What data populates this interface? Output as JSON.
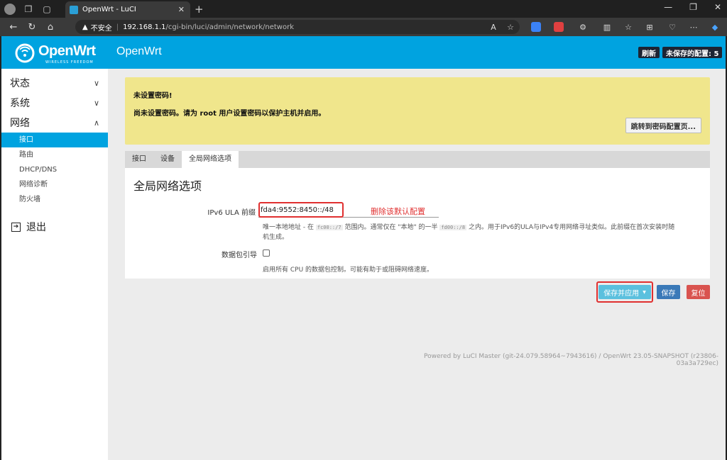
{
  "browser": {
    "tab_title": "OpenWrt - LuCI",
    "security_label": "不安全",
    "url_host": "192.168.1.1",
    "url_path": "/cgi-bin/luci/admin/network/network"
  },
  "header": {
    "logo_text": "OpenWrt",
    "logo_tagline": "WIRELESS FREEDOM",
    "brand": "OpenWrt",
    "refresh_label": "刷新",
    "unsaved_label": "未保存的配置: 5"
  },
  "sidebar": {
    "sections": [
      {
        "label": "状态"
      },
      {
        "label": "系统"
      },
      {
        "label": "网络"
      }
    ],
    "network_items": [
      "接口",
      "路由",
      "DHCP/DNS",
      "网络诊断",
      "防火墙"
    ],
    "logout_label": "退出"
  },
  "alert": {
    "title": "未设置密码!",
    "message": "尚未设置密码。请为 root 用户设置密码以保护主机并启用。",
    "button_label": "跳转到密码配置页..."
  },
  "tabs": [
    "接口",
    "设备",
    "全局网络选项"
  ],
  "panel": {
    "title": "全局网络选项",
    "ula_label": "IPv6 ULA 前缀",
    "ula_value": "fda4:9552:8450::/48",
    "annotation": "删除该默认配置",
    "ula_help_1": "唯一本地地址 - 在",
    "ula_help_code1": "fc00::/7",
    "ula_help_2": "范围内。通常仅在 \"本地\" 的一半",
    "ula_help_code2": "fd00::/8",
    "ula_help_3": "之内。用于IPv6的ULA与IPv4专用网络寻址类似。此前缀在首次安装时随",
    "ula_help_4": "机生成。",
    "steering_label": "数据包引导",
    "steering_help": "启用所有 CPU 的数据包控制。可能有助于或阻碍网络速度。"
  },
  "actions": {
    "save_apply": "保存并应用",
    "save": "保存",
    "reset": "复位"
  },
  "footer": "Powered by LuCI Master (git-24.079.58964~7943616) / OpenWrt 23.05-SNAPSHOT (r23806-03a3a729ec)",
  "colors": {
    "accent": "#00a3e0",
    "alert_bg": "#f0e68c",
    "annotation": "#e03030",
    "save_btn": "#3a79b8",
    "reset_btn": "#d9534f",
    "apply_btn": "#5bc0de"
  }
}
